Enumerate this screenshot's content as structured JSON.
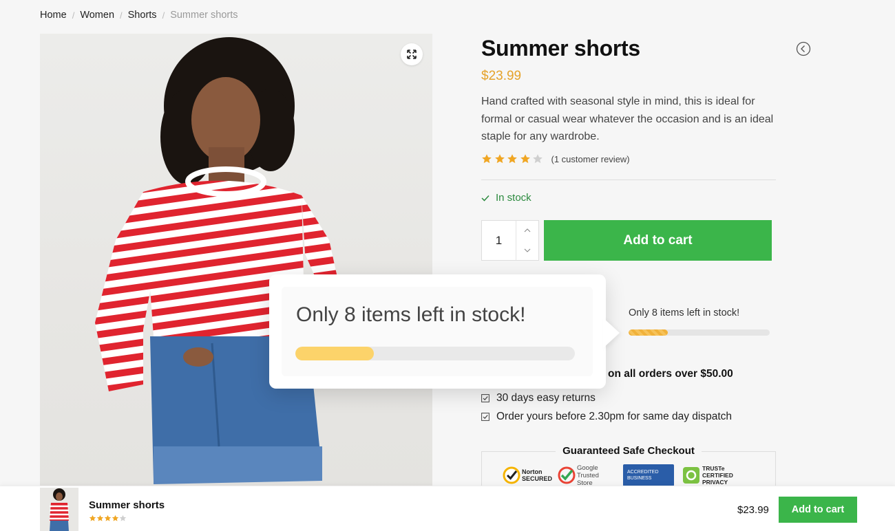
{
  "breadcrumb": {
    "items": [
      "Home",
      "Women",
      "Shorts"
    ],
    "current": "Summer shorts"
  },
  "product": {
    "title": "Summer shorts",
    "price": "$23.99",
    "description": "Hand crafted with seasonal style in mind, this is ideal for formal or casual wear whatever the occasion and is an ideal staple for any wardrobe.",
    "rating": 4,
    "rating_max": 5,
    "review_link": "(1 customer review)",
    "stock_status": "In stock",
    "quantity": "1",
    "add_to_cart": "Add to cart"
  },
  "stock_meter": {
    "text": "Only 8 items left in stock!",
    "level": 0.28
  },
  "popup": {
    "text": "Only 8 items left in stock!",
    "level": 0.28
  },
  "benefits": {
    "shipping": "on all orders over $50.00",
    "returns": "30 days easy returns",
    "dispatch": "Order yours before 2.30pm for same day dispatch"
  },
  "safe_checkout": {
    "title": "Guaranteed Safe Checkout",
    "badges": [
      "Norton SECURED",
      "Google Trusted Store",
      "ACCREDITED BUSINESS",
      "TRUSTe CERTIFIED PRIVACY"
    ]
  },
  "sticky": {
    "title": "Summer shorts",
    "rating": 4,
    "price": "$23.99",
    "button": "Add to cart"
  },
  "colors": {
    "accent_green": "#3bb54a",
    "price_orange": "#e5a229",
    "stock_green": "#2b8a3e",
    "star": "#f0a623"
  },
  "icons": [
    "fullscreen-icon",
    "back-circle-icon",
    "check-icon",
    "chevron-up-icon",
    "chevron-down-icon",
    "checkbox-icon",
    "star-icon"
  ]
}
